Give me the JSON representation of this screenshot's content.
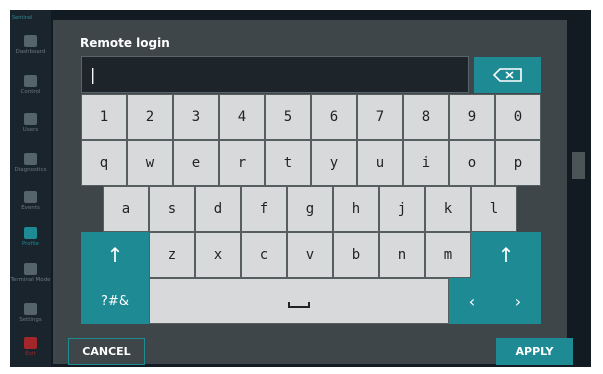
{
  "sidebar": {
    "brand": "Sentinel",
    "items": [
      {
        "label": "Dashboard",
        "icon": "dashboard-icon"
      },
      {
        "label": "Control",
        "icon": "gear-icon"
      },
      {
        "label": "Users",
        "icon": "users-icon"
      },
      {
        "label": "Diagnostics",
        "icon": "diagnostics-icon"
      },
      {
        "label": "Events",
        "icon": "events-icon"
      },
      {
        "label": "Profile",
        "icon": "profile-icon"
      },
      {
        "label": "Terminal Mode",
        "icon": "terminal-icon"
      },
      {
        "label": "Settings",
        "icon": "settings-icon"
      },
      {
        "label": "Exit",
        "icon": "exit-icon"
      }
    ]
  },
  "dialog": {
    "title": "Remote login",
    "input_value": "|",
    "backspace_icon": "backspace-icon",
    "cancel_label": "CANCEL",
    "apply_label": "APPLY"
  },
  "keyboard": {
    "row1": [
      "1",
      "2",
      "3",
      "4",
      "5",
      "6",
      "7",
      "8",
      "9",
      "0"
    ],
    "row2": [
      "q",
      "w",
      "e",
      "r",
      "t",
      "y",
      "u",
      "i",
      "o",
      "p"
    ],
    "row3": [
      "a",
      "s",
      "d",
      "f",
      "g",
      "h",
      "j",
      "k",
      "l"
    ],
    "row4": [
      "z",
      "x",
      "c",
      "v",
      "b",
      "n",
      "m"
    ],
    "shift_glyph": "↑",
    "symbols_label": "?#&",
    "left_glyph": "‹",
    "right_glyph": "›"
  },
  "colors": {
    "accent": "#1d8a94",
    "dialog_bg": "#3e4649",
    "key_bg": "#d7d9da",
    "input_bg": "#1d242a"
  }
}
